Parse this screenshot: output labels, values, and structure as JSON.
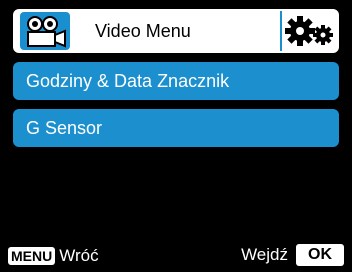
{
  "header": {
    "title": "Video Menu",
    "icon": "video-camera-icon",
    "settings_icon": "gears-icon"
  },
  "menu": {
    "items": [
      {
        "label": "Godziny & Data Znacznik"
      },
      {
        "label": "G Sensor"
      }
    ]
  },
  "footer": {
    "left_key": "MENU",
    "left_label": "Wróć",
    "right_label": "Wejdź",
    "right_key": "OK"
  },
  "colors": {
    "accent": "#1c8fcf",
    "background": "#000000"
  }
}
